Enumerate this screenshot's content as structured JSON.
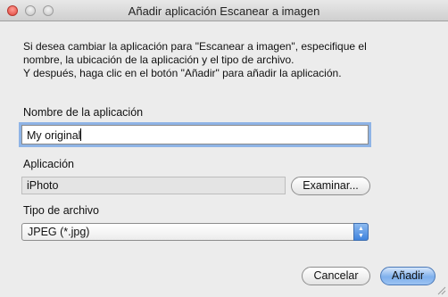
{
  "window": {
    "title": "Añadir aplicación Escanear a imagen"
  },
  "description": {
    "line1": "Si desea cambiar la aplicación para \"Escanear a imagen\", especifique el",
    "line2": "nombre, la ubicación de la aplicación y el tipo de archivo.",
    "line3": "Y después, haga clic en el botón \"Añadir\" para añadir la aplicación."
  },
  "app_name": {
    "label": "Nombre de la aplicación",
    "value": "My original"
  },
  "application": {
    "label": "Aplicación",
    "value": "iPhoto",
    "browse_label": "Examinar..."
  },
  "file_type": {
    "label": "Tipo de archivo",
    "selected": "JPEG (*.jpg)"
  },
  "buttons": {
    "cancel": "Cancelar",
    "add": "Añadir"
  },
  "icons": {
    "popup": "up-down-arrows-icon",
    "resize": "resize-grip-icon"
  },
  "colors": {
    "accent": "#6fa6ea",
    "focus_ring": "#8fb4e6",
    "close": "#e0443a"
  }
}
